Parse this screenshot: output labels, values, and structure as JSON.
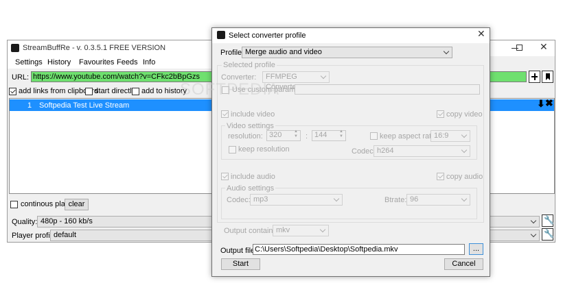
{
  "main_window": {
    "menu": [
      "Settings",
      "History",
      "Favourites",
      "Feeds",
      "Info"
    ],
    "title": "StreamBuffRe - v. 0.3.5.1 FREE VERSION",
    "url_label": "URL:",
    "url_value": "https://www.youtube.com/watch?v=CFkc2bBpGzs",
    "options": {
      "add_links": "add links from clipboard",
      "start_directly": "start directly",
      "add_history": "add to history"
    },
    "list": [
      {
        "num": "1",
        "title": "Softpedia Test Live Stream"
      }
    ],
    "continous_play": "continous play",
    "clear_label": "clear",
    "quality_label": "Quality:",
    "quality_value": "480p - 160 kb/s",
    "player_label": "Player profile:",
    "player_value": "default",
    "plus_icon": "plus-icon",
    "bookmark_icon": "bookmark-icon",
    "wrench_icon": "wrench-icon"
  },
  "dialog": {
    "title": "Select converter profile",
    "profile_label": "Profile:",
    "profile_value": "Merge audio and video",
    "selected_profile_label": "Selected profile",
    "converter_label": "Converter:",
    "converter_value": "FFMPEG Converter",
    "custom_param_label": "Use custom parameter:",
    "include_video": "include video",
    "copy_video": "copy video",
    "video_settings_label": "Video settings",
    "resolution_label": "resolution:",
    "res_width": "320",
    "res_sep": ":",
    "res_height": "144",
    "keep_aspect": "keep aspect ratio",
    "aspect_value": "16:9",
    "keep_resolution": "keep resolution",
    "video_codec_label": "Codec:",
    "video_codec_value": "h264",
    "include_audio": "include audio",
    "copy_audio": "copy audio",
    "audio_settings_label": "Audio settings",
    "audio_codec_label": "Codec:",
    "audio_codec_value": "mp3",
    "bitrate_label": "Btrate:",
    "bitrate_value": "96",
    "output_container_label": "Output container:",
    "output_container_value": "mkv",
    "output_file_label": "Output file:",
    "output_file_value": "C:\\Users\\Softpedia\\Desktop\\Softpedia.mkv",
    "browse_label": "...",
    "start_label": "Start",
    "cancel_label": "Cancel"
  },
  "watermark": "SOFTPEDIA"
}
